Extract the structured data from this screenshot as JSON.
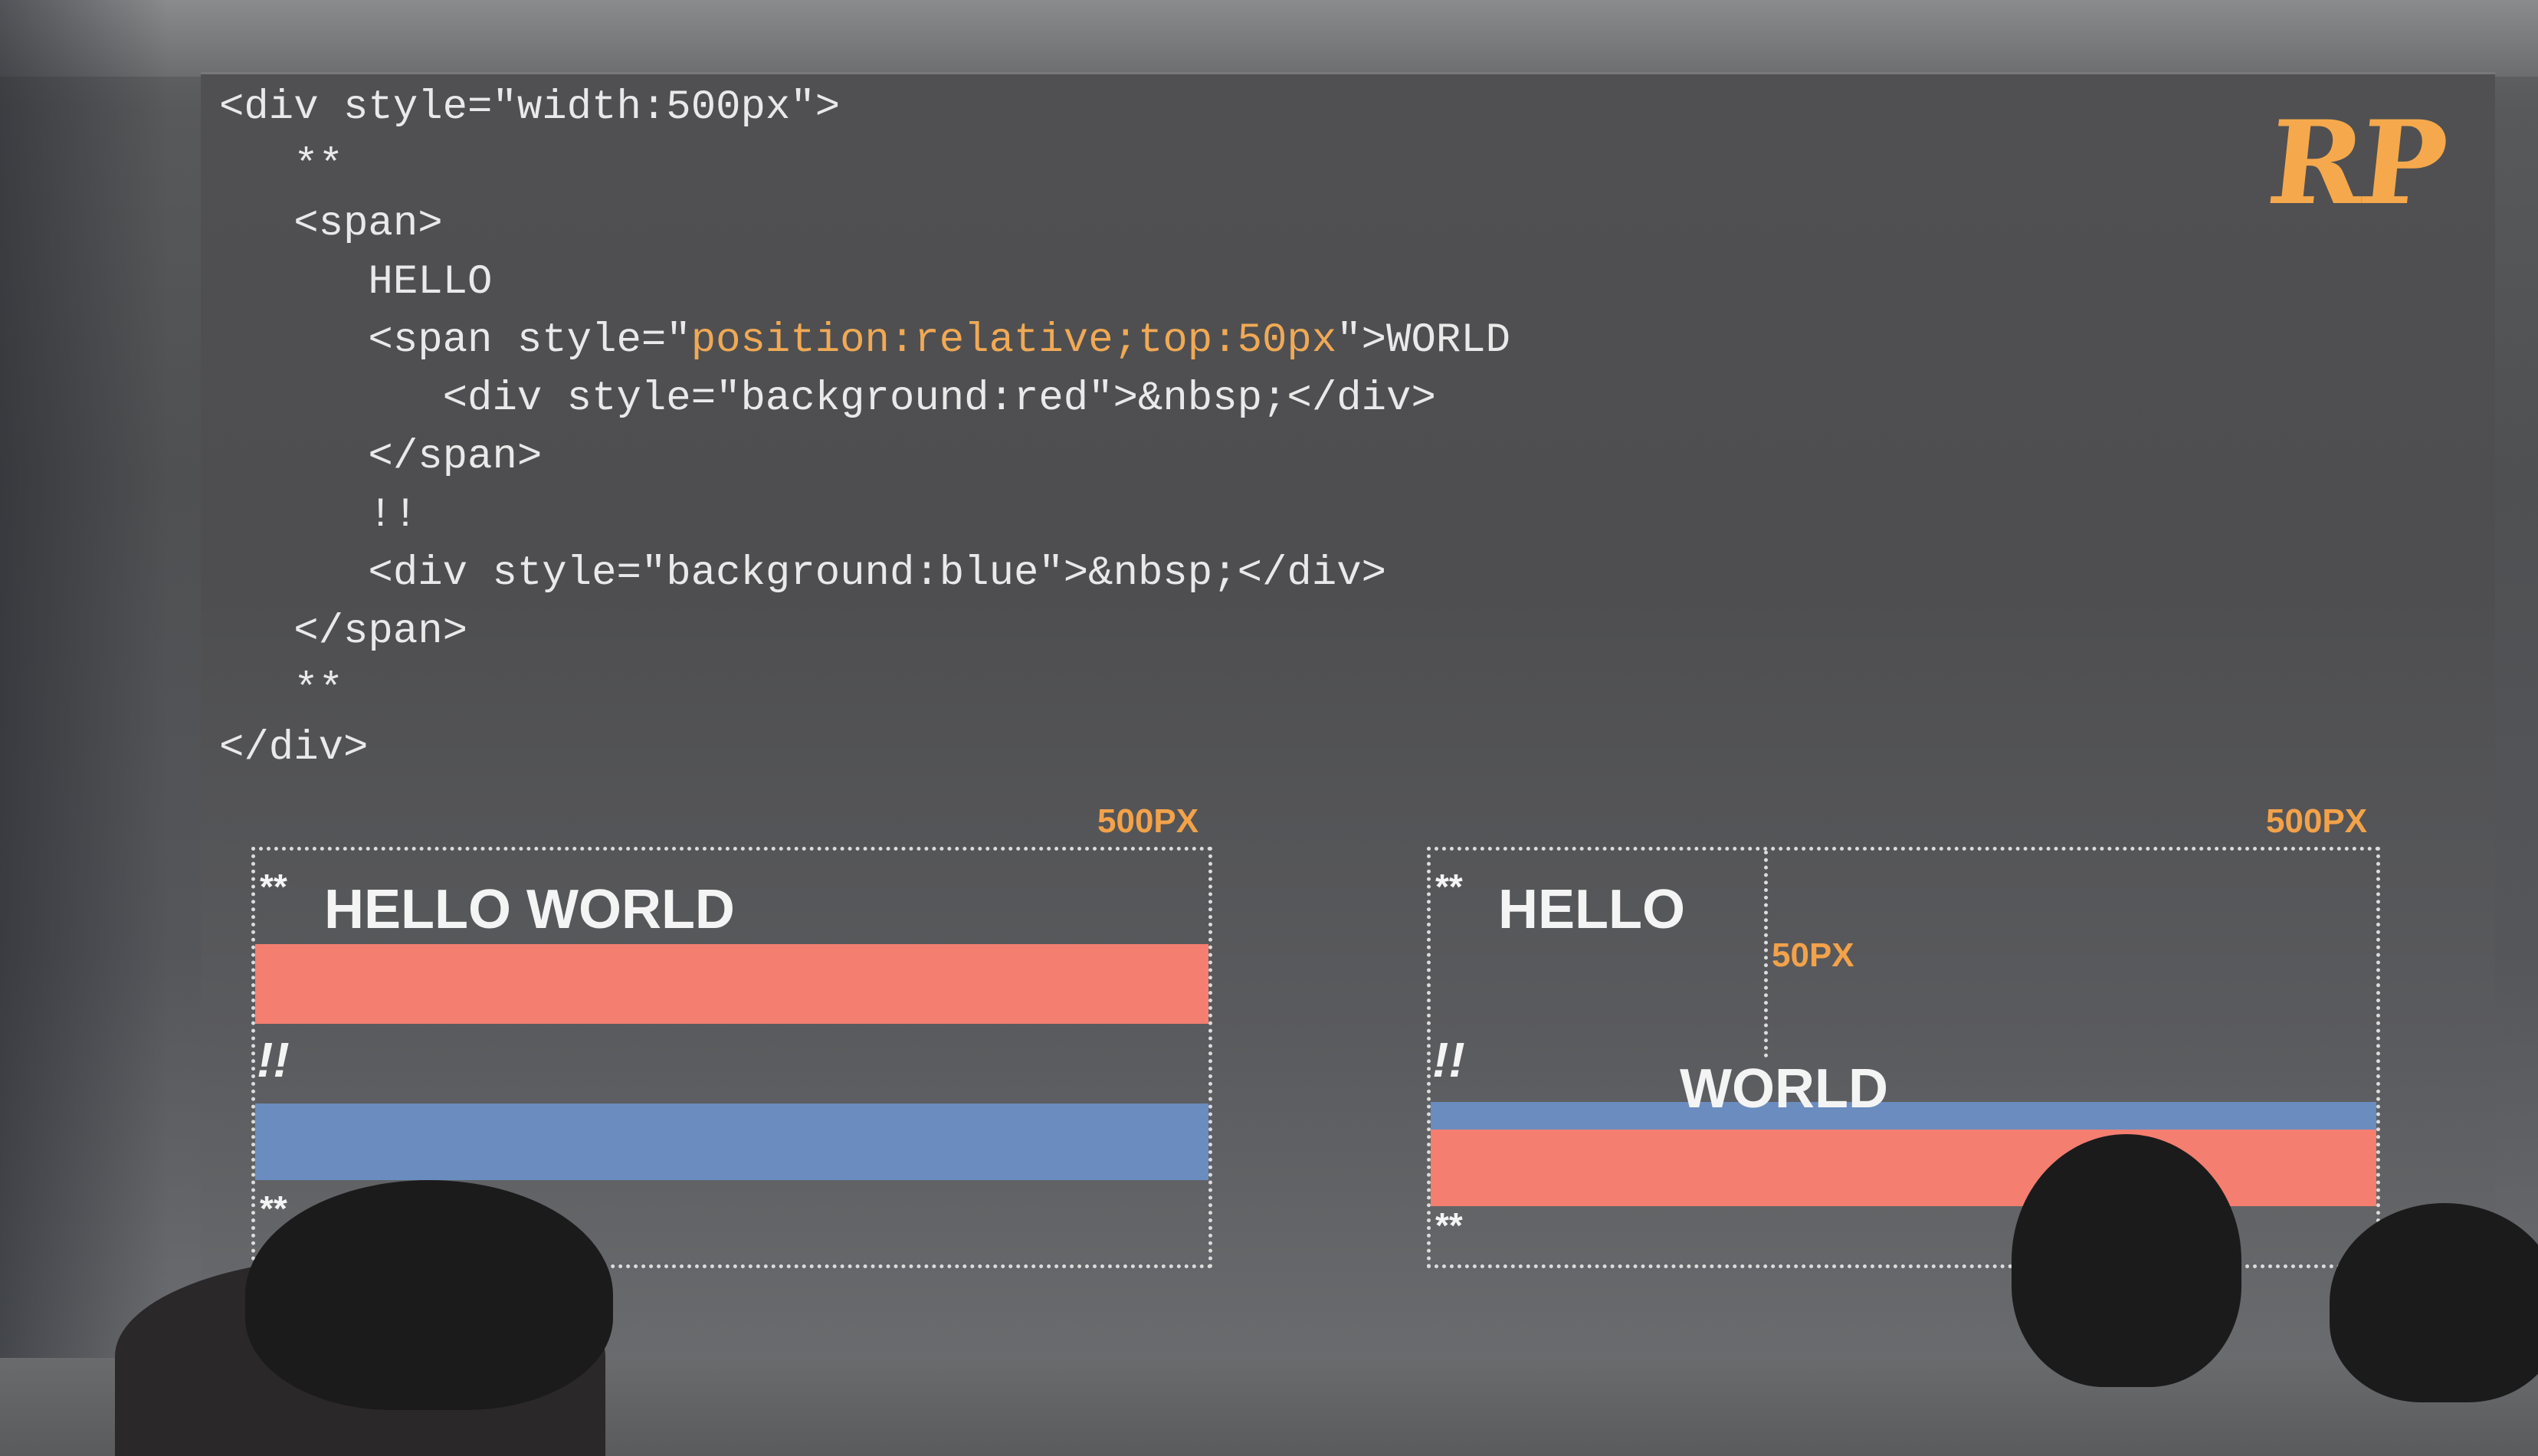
{
  "logo": "RP",
  "code_lines": [
    "<div style=\"width:500px\">",
    "   **",
    "   <span>",
    "      HELLO",
    "      <span style=\"",
    "         <div style=\"background:red\">&nbsp;</div>",
    "      </span>",
    "      !!",
    "      <div style=\"background:blue\">&nbsp;</div>",
    "   </span>",
    "   **",
    "</div>"
  ],
  "code_highlight": "position:relative;top:50px",
  "code_line5_tail": "\">WORLD",
  "left_demo": {
    "width_label": "500PX",
    "stars_top": "**",
    "text": "HELLO WORLD",
    "bang": "!!",
    "stars_bottom": "**"
  },
  "right_demo": {
    "width_label": "500PX",
    "stars_top": "**",
    "text_hello": "HELLO",
    "offset_label": "50PX",
    "bang": "!!",
    "text_world": "WORLD",
    "stars_bottom": "**"
  },
  "colors": {
    "red_block": "#f47e70",
    "blue_block": "#6a8cbf",
    "accent_orange": "#f0a955"
  }
}
